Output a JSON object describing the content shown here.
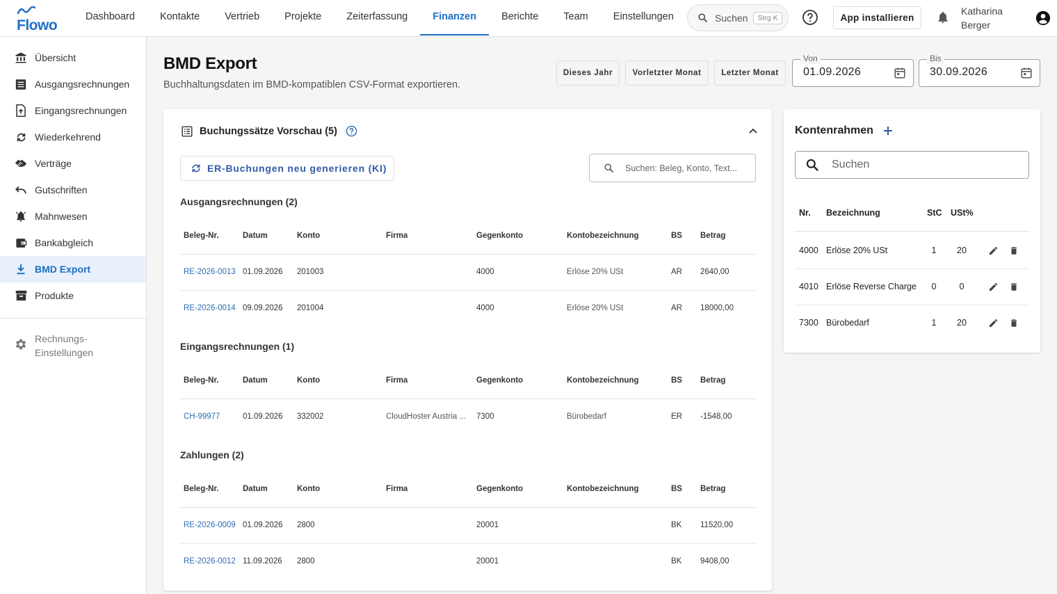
{
  "app": {
    "logo_text": "Flowo"
  },
  "nav": [
    {
      "label": "Dashboard"
    },
    {
      "label": "Kontakte"
    },
    {
      "label": "Vertrieb"
    },
    {
      "label": "Projekte"
    },
    {
      "label": "Zeiterfassung"
    },
    {
      "label": "Finanzen"
    },
    {
      "label": "Berichte"
    },
    {
      "label": "Team"
    },
    {
      "label": "Einstellungen"
    }
  ],
  "header": {
    "search_label": "Suchen",
    "search_shortcut": "Strg K",
    "install_label": "App installieren",
    "user_first": "Katharina",
    "user_last": "Berger",
    "accent": "#1e6fc4"
  },
  "sidebar": {
    "items": [
      {
        "label": "Übersicht"
      },
      {
        "label": "Ausgangsrechnungen"
      },
      {
        "label": "Eingangsrechnungen"
      },
      {
        "label": "Wiederkehrend"
      },
      {
        "label": "Verträge"
      },
      {
        "label": "Gutschriften"
      },
      {
        "label": "Mahnwesen"
      },
      {
        "label": "Bankabgleich"
      },
      {
        "label": "BMD Export"
      },
      {
        "label": "Produkte"
      }
    ],
    "settings_line1": "Rechnungs-",
    "settings_line2": "Einstellungen"
  },
  "page": {
    "title": "BMD Export",
    "subtitle": "Buchhaltungsdaten im BMD-kompatiblen CSV-Format exportieren.",
    "quick": [
      "Dieses Jahr",
      "Vorletzter Monat",
      "Letzter Monat"
    ],
    "from_label": "Von",
    "from_value": "01.09.2026",
    "to_label": "Bis",
    "to_value": "30.09.2026"
  },
  "preview": {
    "title": "Buchungssätze Vorschau (5)",
    "regen_label": "ER-Buchungen neu generieren (KI)",
    "search_placeholder": "Suchen: Beleg, Konto, Text...",
    "columns": [
      "Beleg-Nr.",
      "Datum",
      "Konto",
      "Firma",
      "Gegenkonto",
      "Kontobezeichnung",
      "BS",
      "Betrag"
    ],
    "sections": [
      {
        "title": "Ausgangsrechnungen (2)",
        "rows": [
          [
            "RE-2026-0013",
            "01.09.2026",
            "201003",
            "",
            "4000",
            "Erlöse 20% USt",
            "AR",
            "2640,00"
          ],
          [
            "RE-2026-0014",
            "09.09.2026",
            "201004",
            "",
            "4000",
            "Erlöse 20% USt",
            "AR",
            "18000,00"
          ]
        ]
      },
      {
        "title": "Eingangsrechnungen (1)",
        "rows": [
          [
            "CH-99977",
            "01.09.2026",
            "332002",
            "CloudHoster Austria ...",
            "7300",
            "Bürobedarf",
            "ER",
            "-1548,00"
          ]
        ]
      },
      {
        "title": "Zahlungen (2)",
        "rows": [
          [
            "RE-2026-0009",
            "01.09.2026",
            "2800",
            "",
            "20001",
            "",
            "BK",
            "11520,00"
          ],
          [
            "RE-2026-0012",
            "11.09.2026",
            "2800",
            "",
            "20001",
            "",
            "BK",
            "9408,00"
          ]
        ]
      }
    ]
  },
  "kontenrahmen": {
    "title": "Kontenrahmen",
    "search_placeholder": "Suchen",
    "columns": [
      "Nr.",
      "Bezeichnung",
      "StC",
      "USt%"
    ],
    "rows": [
      [
        "4000",
        "Erlöse 20% USt",
        "1",
        "20"
      ],
      [
        "4010",
        "Erlöse Reverse Charge",
        "0",
        "0"
      ],
      [
        "7300",
        "Bürobedarf",
        "1",
        "20"
      ]
    ]
  }
}
